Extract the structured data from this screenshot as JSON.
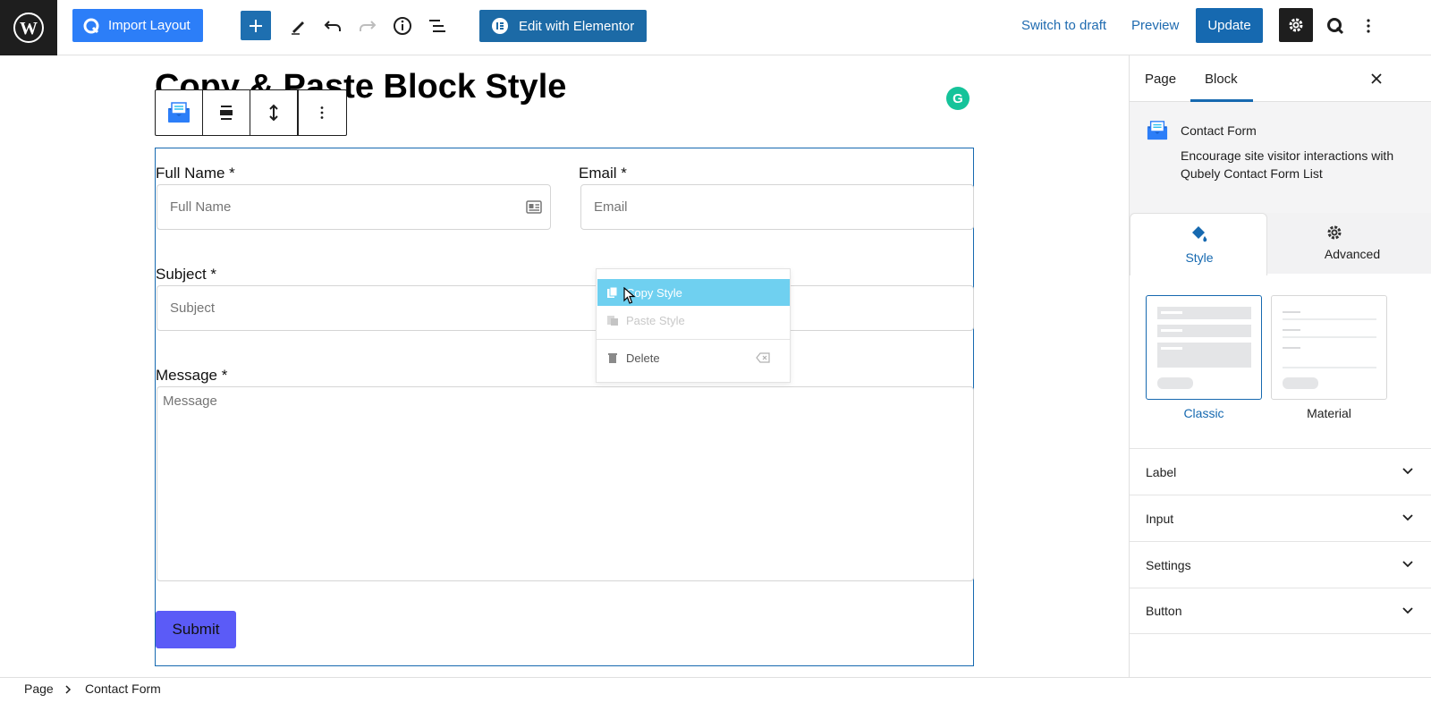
{
  "topbar": {
    "import_label": "Import Layout",
    "elementor_label": "Edit with Elementor",
    "switch_draft": "Switch to draft",
    "preview": "Preview",
    "update": "Update"
  },
  "editor": {
    "page_title": "Copy & Paste Block Style",
    "form": {
      "full_name_label": "Full Name *",
      "full_name_placeholder": "Full Name",
      "email_label": "Email *",
      "email_placeholder": "Email",
      "subject_label": "Subject *",
      "subject_placeholder": "Subject",
      "message_label": "Message *",
      "message_placeholder": "Message",
      "submit": "Submit"
    },
    "context_menu": {
      "copy_style": "Copy Style",
      "paste_style": "Paste Style",
      "delete": "Delete"
    }
  },
  "sidebar": {
    "tabs": [
      "Page",
      "Block"
    ],
    "block_name": "Contact Form",
    "block_description": "Encourage site visitor interactions with Qubely Contact Form List",
    "style_tab": "Style",
    "advanced_tab": "Advanced",
    "variants": [
      "Classic",
      "Material"
    ],
    "panels": [
      "Label",
      "Input",
      "Settings",
      "Button"
    ]
  },
  "breadcrumb": [
    "Page",
    "Contact Form"
  ],
  "colors": {
    "accent": "#1669b0",
    "import_button": "#2c7ef8",
    "submit_button": "#5b5bf7",
    "menu_hover": "#6fd0f0",
    "grammarly": "#15c39a"
  }
}
